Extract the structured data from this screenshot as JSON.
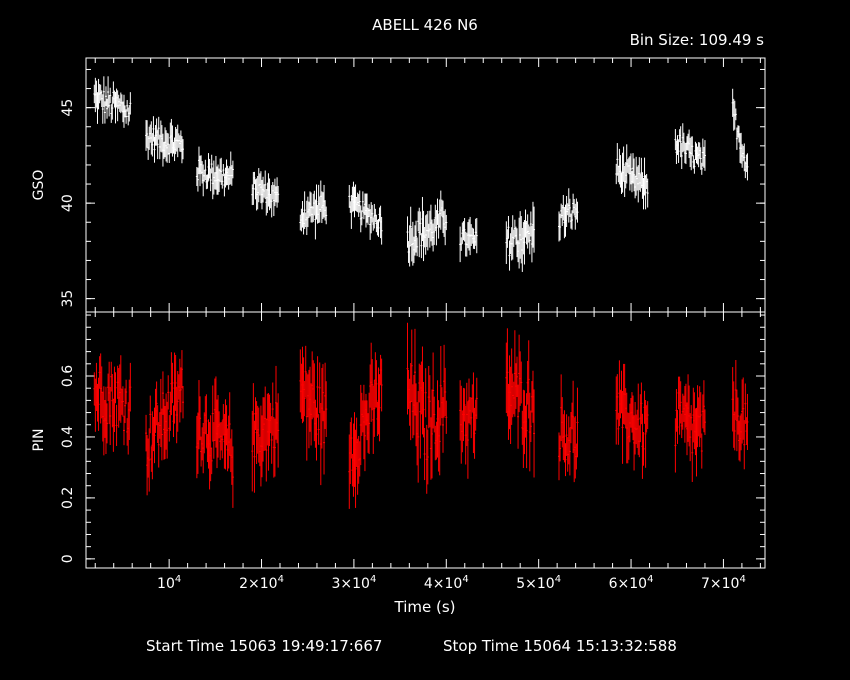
{
  "title": "ABELL 426 N6",
  "bin_size_label": "Bin Size: 109.49 s",
  "footer": {
    "start": "Start Time 15063 19:49:17:667",
    "stop": "Stop Time 15064 15:13:32:588"
  },
  "colors": {
    "background": "#000000",
    "axes": "#ffffff",
    "gso": "#ffffff",
    "pin": "#ff0000"
  },
  "chart_data": [
    {
      "type": "scatter",
      "name": "GSO",
      "ylabel": "GSO",
      "xlabel": "",
      "xlim": [
        1000,
        74500
      ],
      "ylim": [
        34.3,
        47.6
      ],
      "yticks": [
        35,
        40,
        45
      ],
      "ytick_labels": [
        "35",
        "40",
        "45"
      ],
      "color": "#ffffff",
      "segments": [
        {
          "x": [
            1900,
            5800
          ],
          "y": [
            45.5,
            44.8
          ],
          "noise": 0.7,
          "err": 0.6
        },
        {
          "x": [
            7500,
            11500
          ],
          "y": [
            43.5,
            43.0
          ],
          "noise": 0.6,
          "err": 0.6
        },
        {
          "x": [
            13000,
            16900
          ],
          "y": [
            41.7,
            41.3
          ],
          "noise": 0.6,
          "err": 0.6
        },
        {
          "x": [
            19000,
            21800
          ],
          "y": [
            40.9,
            40.2
          ],
          "noise": 0.5,
          "err": 0.6
        },
        {
          "x": [
            24200,
            27000
          ],
          "y": [
            39.4,
            39.9
          ],
          "noise": 0.6,
          "err": 0.7
        },
        {
          "x": [
            29500,
            33000
          ],
          "y": [
            40.0,
            39.0
          ],
          "noise": 0.5,
          "err": 0.6
        },
        {
          "x": [
            35800,
            38000
          ],
          "y": [
            38.2,
            38.6
          ],
          "noise": 0.8,
          "err": 0.9
        },
        {
          "x": [
            38100,
            40000
          ],
          "y": [
            38.5,
            39.3
          ],
          "noise": 0.7,
          "err": 0.7
        },
        {
          "x": [
            41500,
            43300
          ],
          "y": [
            38.2,
            38.0
          ],
          "noise": 0.5,
          "err": 0.7
        },
        {
          "x": [
            46500,
            49500
          ],
          "y": [
            38.0,
            38.4
          ],
          "noise": 0.8,
          "err": 0.9
        },
        {
          "x": [
            52200,
            54200
          ],
          "y": [
            39.2,
            39.6
          ],
          "noise": 0.6,
          "err": 0.6
        },
        {
          "x": [
            58400,
            61800
          ],
          "y": [
            41.8,
            40.8
          ],
          "noise": 0.6,
          "err": 0.7
        },
        {
          "x": [
            64800,
            68000
          ],
          "y": [
            43.2,
            42.0
          ],
          "noise": 0.6,
          "err": 0.6
        },
        {
          "x": [
            71000,
            72600
          ],
          "y": [
            44.8,
            41.9
          ],
          "noise": 0.6,
          "err": 0.6
        }
      ]
    },
    {
      "type": "scatter",
      "name": "PIN",
      "ylabel": "PIN",
      "xlabel": "Time (s)",
      "xlim": [
        1000,
        74500
      ],
      "ylim": [
        -0.03,
        0.81
      ],
      "yticks": [
        0,
        0.2,
        0.4,
        0.6
      ],
      "ytick_labels": [
        "0",
        "0.2",
        "0.4",
        "0.6"
      ],
      "xticks": [
        10000,
        20000,
        30000,
        40000,
        50000,
        60000,
        70000
      ],
      "xtick_mantissa": [
        "",
        "2×10",
        "3×10",
        "4×10",
        "5×10",
        "6×10",
        "7×10"
      ],
      "xtick_base": "10",
      "xtick_exp": "4",
      "color": "#ff0000",
      "segments": [
        {
          "x": [
            1900,
            5800
          ],
          "y": [
            0.55,
            0.5
          ],
          "noise": 0.09,
          "err": 0.08
        },
        {
          "x": [
            7500,
            11500
          ],
          "y": [
            0.38,
            0.55
          ],
          "noise": 0.09,
          "err": 0.08
        },
        {
          "x": [
            13000,
            16900
          ],
          "y": [
            0.45,
            0.35
          ],
          "noise": 0.09,
          "err": 0.08
        },
        {
          "x": [
            19000,
            21800
          ],
          "y": [
            0.4,
            0.45
          ],
          "noise": 0.08,
          "err": 0.09
        },
        {
          "x": [
            24200,
            27000
          ],
          "y": [
            0.55,
            0.45
          ],
          "noise": 0.1,
          "err": 0.1
        },
        {
          "x": [
            29500,
            33000
          ],
          "y": [
            0.35,
            0.55
          ],
          "noise": 0.1,
          "err": 0.09
        },
        {
          "x": [
            35800,
            38000
          ],
          "y": [
            0.55,
            0.42
          ],
          "noise": 0.12,
          "err": 0.11
        },
        {
          "x": [
            38100,
            40000
          ],
          "y": [
            0.45,
            0.5
          ],
          "noise": 0.1,
          "err": 0.1
        },
        {
          "x": [
            41500,
            43300
          ],
          "y": [
            0.48,
            0.45
          ],
          "noise": 0.09,
          "err": 0.09
        },
        {
          "x": [
            46500,
            49500
          ],
          "y": [
            0.55,
            0.5
          ],
          "noise": 0.1,
          "err": 0.1
        },
        {
          "x": [
            52200,
            54200
          ],
          "y": [
            0.42,
            0.4
          ],
          "noise": 0.09,
          "err": 0.08
        },
        {
          "x": [
            58400,
            61800
          ],
          "y": [
            0.48,
            0.42
          ],
          "noise": 0.08,
          "err": 0.08
        },
        {
          "x": [
            64800,
            68000
          ],
          "y": [
            0.45,
            0.4
          ],
          "noise": 0.1,
          "err": 0.08
        },
        {
          "x": [
            71000,
            72600
          ],
          "y": [
            0.5,
            0.42
          ],
          "noise": 0.08,
          "err": 0.08
        }
      ]
    }
  ]
}
